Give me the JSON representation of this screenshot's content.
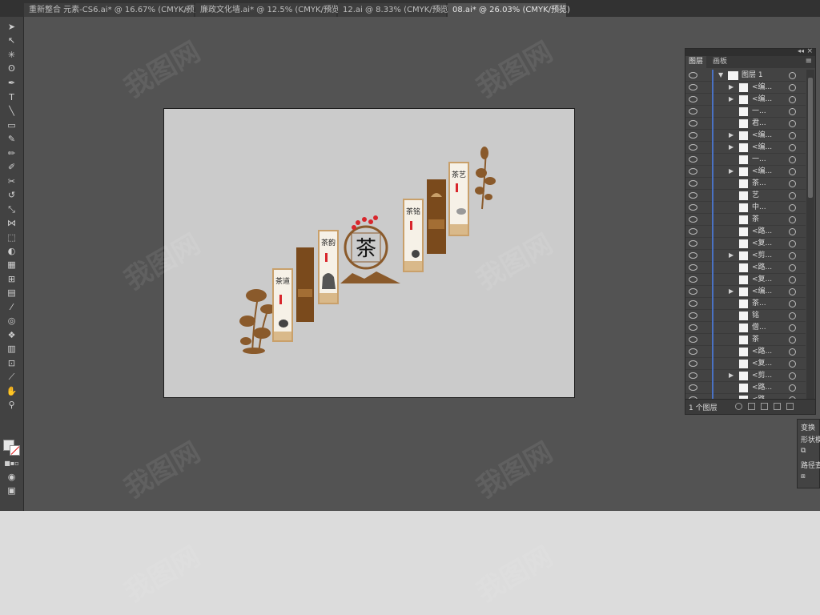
{
  "tabs": [
    {
      "label": "重新整合 元素-CS6.ai* @ 16.67% (CMYK/预览)",
      "active": false
    },
    {
      "label": "廉政文化墙.ai* @ 12.5% (CMYK/预览)",
      "active": false
    },
    {
      "label": "12.ai @ 8.33% (CMYK/预览)",
      "active": false
    },
    {
      "label": "08.ai* @ 26.03% (CMYK/预览)",
      "active": true
    }
  ],
  "tab_close_symbol": "×",
  "tools": [
    "selection-tool",
    "direct-selection-tool",
    "magic-wand-tool",
    "lasso-tool",
    "pen-tool",
    "type-tool",
    "line-tool",
    "rectangle-tool",
    "paintbrush-tool",
    "pencil-tool",
    "blob-brush-tool",
    "eraser-tool",
    "rotate-tool",
    "scale-tool",
    "width-tool",
    "free-transform-tool",
    "shape-builder-tool",
    "perspective-grid-tool",
    "mesh-tool",
    "gradient-tool",
    "eyedropper-tool",
    "blend-tool",
    "symbol-sprayer-tool",
    "column-graph-tool",
    "artboard-tool",
    "slice-tool",
    "hand-tool",
    "zoom-tool"
  ],
  "artwork": {
    "center_char": "茶",
    "panels": [
      {
        "title": "茶道",
        "style": "light"
      },
      {
        "title": "",
        "style": "dark"
      },
      {
        "title": "茶韵",
        "style": "light"
      },
      {
        "title": "茶铭",
        "style": "light"
      },
      {
        "title": "",
        "style": "dark"
      },
      {
        "title": "茶艺",
        "style": "light"
      }
    ],
    "accent_color": "#8a5a2b",
    "dark_panel_color": "#7a4a1c",
    "red_color": "#d8262c"
  },
  "layers_panel": {
    "tabs": [
      "图层",
      "画板"
    ],
    "menu_icon": "≡",
    "collapse_icon": "◂◂",
    "close_icon": "×",
    "top_layer": "图层 1",
    "rows": [
      {
        "name": "<编...",
        "arrow": true
      },
      {
        "name": "<编...",
        "arrow": true
      },
      {
        "name": "一...",
        "arrow": false
      },
      {
        "name": "君...",
        "arrow": false
      },
      {
        "name": "<编...",
        "arrow": true
      },
      {
        "name": "<编...",
        "arrow": true
      },
      {
        "name": "一...",
        "arrow": false
      },
      {
        "name": "<编...",
        "arrow": true
      },
      {
        "name": "茶...",
        "arrow": false
      },
      {
        "name": "艺",
        "arrow": false
      },
      {
        "name": "中...",
        "arrow": false
      },
      {
        "name": "茶",
        "arrow": false
      },
      {
        "name": "<路...",
        "arrow": false
      },
      {
        "name": "<复...",
        "arrow": false
      },
      {
        "name": "<剪...",
        "arrow": true
      },
      {
        "name": "<路...",
        "arrow": false
      },
      {
        "name": "<复...",
        "arrow": false
      },
      {
        "name": "<编...",
        "arrow": true
      },
      {
        "name": "茶...",
        "arrow": false
      },
      {
        "name": "铭",
        "arrow": false
      },
      {
        "name": "僧...",
        "arrow": false
      },
      {
        "name": "茶",
        "arrow": false
      },
      {
        "name": "<路...",
        "arrow": false
      },
      {
        "name": "<复...",
        "arrow": false
      },
      {
        "name": "<剪...",
        "arrow": true
      },
      {
        "name": "<路...",
        "arrow": false
      },
      {
        "name": "<路...",
        "arrow": false
      }
    ],
    "footer_count": "1 个图层"
  },
  "transform_panel": {
    "tab": "变换",
    "item1": "形状模",
    "item2": "路径查"
  },
  "watermark": "我图网"
}
